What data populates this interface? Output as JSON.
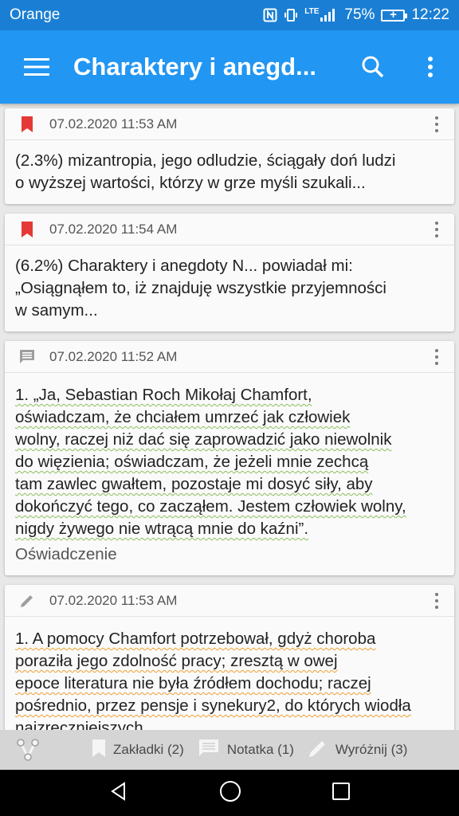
{
  "status_bar": {
    "carrier": "Orange",
    "network": "LTE",
    "battery": "75%",
    "time": "12:22"
  },
  "app_bar": {
    "title": "Charaktery i anegd...",
    "icons": [
      "menu-icon",
      "search-icon",
      "more-vert-icon"
    ]
  },
  "cards": [
    {
      "type": "bookmark",
      "icon": "bookmark-icon",
      "date": "07.02.2020 11:53 AM",
      "lines": [
        "(2.3%) mizantropia, jego odludzie, ściągały doń ludzi",
        "o wyższej wartości, którzy w grze myśli szukali..."
      ]
    },
    {
      "type": "bookmark",
      "icon": "bookmark-icon",
      "date": "07.02.2020 11:54 AM",
      "lines": [
        "(6.2%) Charaktery i anegdoty N... powiadał mi:",
        "„Osiągnąłem to, iż znajduję wszystkie przyjemności",
        "w samym..."
      ]
    },
    {
      "type": "note",
      "icon": "comment-icon",
      "date": "07.02.2020 11:52 AM",
      "lines": [
        "1. „Ja, Sebastian Roch Mikołaj Chamfort,",
        "oświadczam, że chciałem umrzeć jak człowiek",
        "wolny, raczej niż dać się zaprowadzić jako niewolnik",
        "do więzienia; oświadczam, że jeżeli mnie zechcą",
        "tam zawlec gwałtem, pozostaje mi dosyć siły, aby",
        "dokończyć tego, co zacząłem. Jestem człowiek wolny,",
        "nigdy żywego nie wtrącą mnie do kaźni”."
      ],
      "note": "Oświadczenie"
    },
    {
      "type": "highlight",
      "icon": "pencil-icon",
      "date": "07.02.2020 11:53 AM",
      "lines": [
        "1. A pomocy Chamfort potrzebował, gdyż choroba",
        "poraziła jego zdolność pracy; zresztą w owej",
        "epoce literatura nie była źródłem dochodu; raczej",
        "pośrednio, przez pensje i synekury2, do których wiodła",
        "najzręczniejszych."
      ]
    }
  ],
  "bottom_bar": {
    "share_icon": "share-icon",
    "bookmarks_label": "Zakładki (2)",
    "notes_label": "Notatka (1)",
    "highlights_label": "Wyróżnij (3)"
  },
  "nav_bar": {
    "icons": [
      "back-icon",
      "home-icon",
      "recents-icon"
    ]
  },
  "colors": {
    "status_bar": "#1a7fd4",
    "app_bar": "#2196f3",
    "bookmark": "#e53935",
    "spell_green": "#8bbf5c",
    "spell_orange": "#f0a030"
  }
}
